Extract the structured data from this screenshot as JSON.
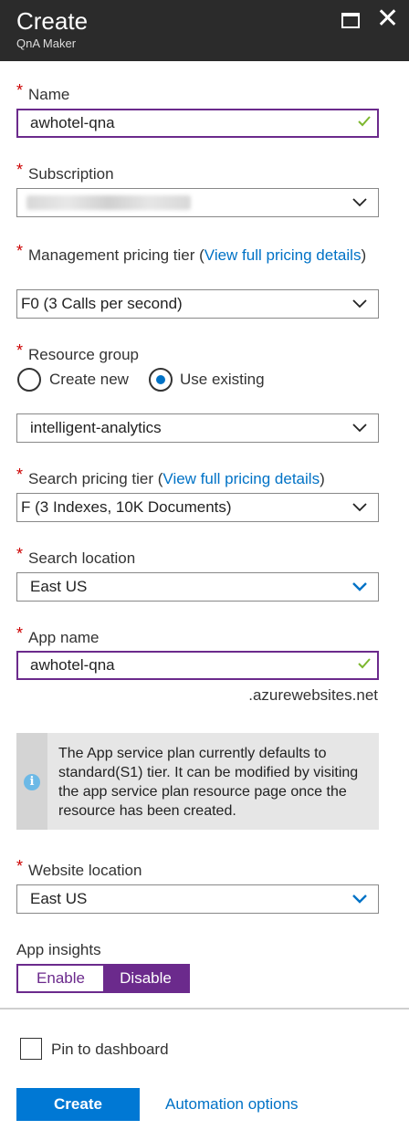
{
  "header": {
    "title": "Create",
    "subtitle": "QnA Maker"
  },
  "required_mark": "*",
  "name": {
    "label": "Name",
    "value": "awhotel-qna"
  },
  "subscription": {
    "label": "Subscription",
    "value": ""
  },
  "management_pricing": {
    "label": "Management pricing tier (",
    "link": "View full pricing details",
    "close": ")",
    "value": "F0 (3 Calls per second)"
  },
  "resource_group": {
    "label": "Resource group",
    "option_new": "Create new",
    "option_existing": "Use existing",
    "value": "intelligent-analytics"
  },
  "search_pricing": {
    "label": "Search pricing tier (",
    "link": "View full pricing details",
    "close": ")",
    "value": "F (3 Indexes, 10K Documents)"
  },
  "search_location": {
    "label": "Search location",
    "value": "East US"
  },
  "app_name": {
    "label": "App name",
    "value": "awhotel-qna",
    "suffix": ".azurewebsites.net"
  },
  "info": {
    "text": "The App service plan currently defaults to standard(S1) tier. It can be modified by visiting the app service plan resource page once the resource has been created.",
    "icon": "i"
  },
  "website_location": {
    "label": "Website location",
    "value": "East US"
  },
  "app_insights": {
    "label": "App insights",
    "enable": "Enable",
    "disable": "Disable"
  },
  "pin": {
    "label": "Pin to dashboard"
  },
  "footer": {
    "create": "Create",
    "automation": "Automation options"
  },
  "colors": {
    "accent_purple": "#6b2a8c",
    "link_blue": "#0072c6",
    "button_blue": "#0078d4",
    "header": "#2b2b2b",
    "required": "#cc0000",
    "valid_green": "#7db72f"
  }
}
